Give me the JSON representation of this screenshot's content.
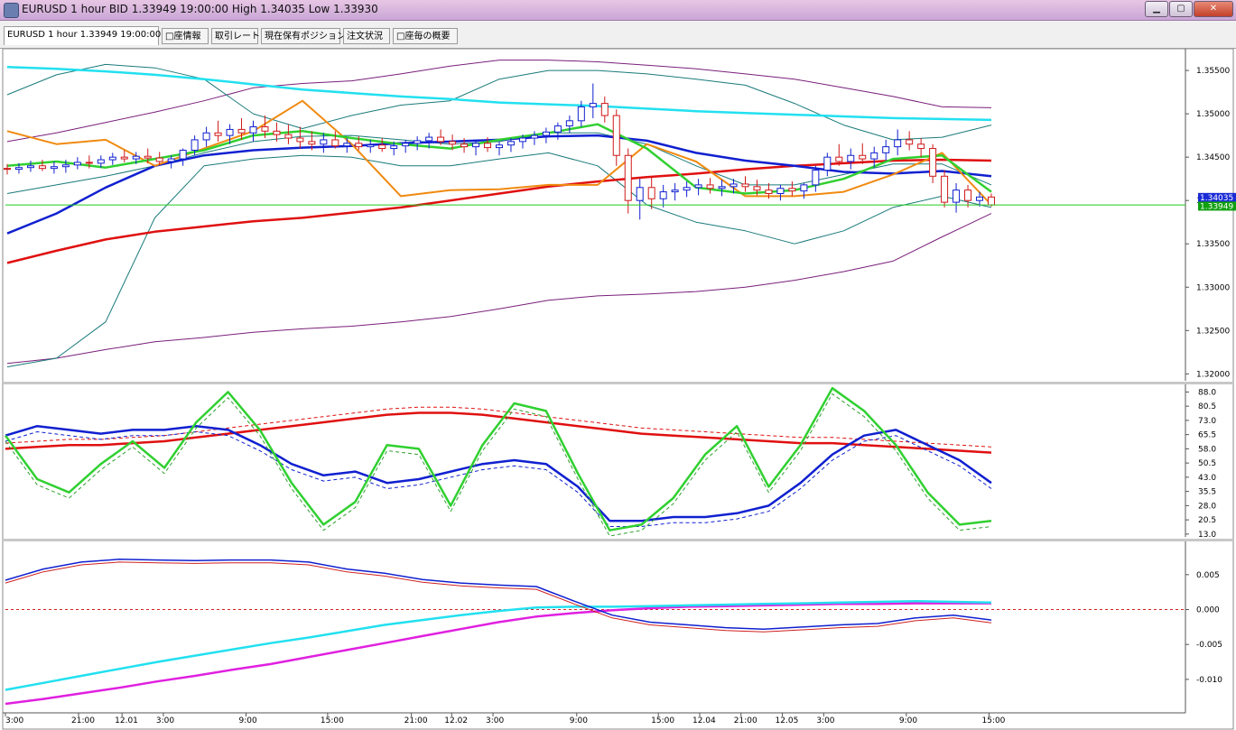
{
  "window": {
    "title": "EURUSD 1 hour BID 1.33949 19:00:00 High 1.34035 Low 1.33930",
    "controls": {
      "minimize": "▁",
      "maximize": "▢",
      "close": "✕"
    }
  },
  "tabs": [
    {
      "label": "EURUSD 1 hour 1.33949 19:00:00",
      "active": true
    },
    {
      "label": "□座情報"
    },
    {
      "label": "取引レート"
    },
    {
      "label": "現在保有ポジション"
    },
    {
      "label": "注文状況"
    },
    {
      "label": "□座毎の概要"
    }
  ],
  "chart_data": [
    {
      "type": "candlestick",
      "panel": "price",
      "y_ticks": [
        "1.35500",
        "1.35000",
        "1.34500",
        "1.34000",
        "1.33500",
        "1.33000",
        "1.32500",
        "1.32000"
      ],
      "ylim": [
        1.3192,
        1.3573
      ],
      "price_labels": [
        {
          "text": "1.34035",
          "value": 1.34035,
          "color": "#1a2bd6"
        },
        {
          "text": "1.33949",
          "value": 1.33935,
          "color": "#10a010"
        }
      ],
      "candles": [
        [
          1.3437,
          1.3442,
          1.343,
          1.3436
        ],
        [
          1.3436,
          1.3443,
          1.3431,
          1.3438
        ],
        [
          1.3438,
          1.3446,
          1.3433,
          1.344
        ],
        [
          1.344,
          1.3447,
          1.3434,
          1.3437
        ],
        [
          1.3437,
          1.3445,
          1.3431,
          1.3439
        ],
        [
          1.3439,
          1.3447,
          1.3432,
          1.3441
        ],
        [
          1.3441,
          1.345,
          1.3436,
          1.3444
        ],
        [
          1.3444,
          1.3452,
          1.3437,
          1.3443
        ],
        [
          1.3443,
          1.3452,
          1.3438,
          1.3447
        ],
        [
          1.3447,
          1.3455,
          1.3441,
          1.345
        ],
        [
          1.345,
          1.3458,
          1.3444,
          1.3448
        ],
        [
          1.3448,
          1.3456,
          1.3442,
          1.3451
        ],
        [
          1.3451,
          1.346,
          1.3443,
          1.3449
        ],
        [
          1.3449,
          1.3456,
          1.3441,
          1.3445
        ],
        [
          1.3445,
          1.3452,
          1.3437,
          1.3448
        ],
        [
          1.3448,
          1.346,
          1.344,
          1.3458
        ],
        [
          1.3458,
          1.3475,
          1.3452,
          1.347
        ],
        [
          1.347,
          1.3485,
          1.3462,
          1.3478
        ],
        [
          1.3478,
          1.3492,
          1.3468,
          1.3475
        ],
        [
          1.3475,
          1.3488,
          1.3465,
          1.3482
        ],
        [
          1.3482,
          1.3495,
          1.347,
          1.3478
        ],
        [
          1.3478,
          1.3492,
          1.3468,
          1.3485
        ],
        [
          1.3485,
          1.3498,
          1.3472,
          1.348
        ],
        [
          1.348,
          1.349,
          1.3468,
          1.3476
        ],
        [
          1.3476,
          1.3488,
          1.3465,
          1.3472
        ],
        [
          1.3472,
          1.3485,
          1.346,
          1.3468
        ],
        [
          1.3468,
          1.348,
          1.3458,
          1.3465
        ],
        [
          1.3465,
          1.3478,
          1.3455,
          1.347
        ],
        [
          1.347,
          1.348,
          1.346,
          1.3463
        ],
        [
          1.3463,
          1.3472,
          1.3455,
          1.3466
        ],
        [
          1.3466,
          1.3474,
          1.3458,
          1.3462
        ],
        [
          1.3462,
          1.347,
          1.3455,
          1.3464
        ],
        [
          1.3464,
          1.3472,
          1.3456,
          1.346
        ],
        [
          1.346,
          1.3468,
          1.3452,
          1.3463
        ],
        [
          1.3463,
          1.347,
          1.3455,
          1.3466
        ],
        [
          1.3466,
          1.3474,
          1.3458,
          1.3469
        ],
        [
          1.3469,
          1.3478,
          1.346,
          1.3473
        ],
        [
          1.3473,
          1.3482,
          1.3464,
          1.3468
        ],
        [
          1.3468,
          1.3476,
          1.3458,
          1.3465
        ],
        [
          1.3465,
          1.3472,
          1.3455,
          1.3462
        ],
        [
          1.3462,
          1.347,
          1.3452,
          1.3466
        ],
        [
          1.3466,
          1.3473,
          1.3456,
          1.3461
        ],
        [
          1.3461,
          1.3468,
          1.3452,
          1.3464
        ],
        [
          1.3464,
          1.3472,
          1.3456,
          1.3468
        ],
        [
          1.3468,
          1.3476,
          1.346,
          1.3472
        ],
        [
          1.3472,
          1.348,
          1.3464,
          1.3475
        ],
        [
          1.3475,
          1.3484,
          1.3466,
          1.3479
        ],
        [
          1.3479,
          1.349,
          1.347,
          1.3486
        ],
        [
          1.3486,
          1.3498,
          1.3478,
          1.3492
        ],
        [
          1.3492,
          1.3515,
          1.3485,
          1.3508
        ],
        [
          1.3508,
          1.3535,
          1.3495,
          1.3512
        ],
        [
          1.3512,
          1.352,
          1.349,
          1.3498
        ],
        [
          1.3498,
          1.3505,
          1.344,
          1.3452
        ],
        [
          1.3452,
          1.346,
          1.3385,
          1.34
        ],
        [
          1.34,
          1.3425,
          1.3378,
          1.3415
        ],
        [
          1.3415,
          1.3428,
          1.339,
          1.3402
        ],
        [
          1.3402,
          1.3418,
          1.3392,
          1.341
        ],
        [
          1.341,
          1.342,
          1.34,
          1.3412
        ],
        [
          1.3412,
          1.3422,
          1.3404,
          1.3415
        ],
        [
          1.3415,
          1.3425,
          1.3406,
          1.3418
        ],
        [
          1.3418,
          1.3426,
          1.3408,
          1.3414
        ],
        [
          1.3414,
          1.3424,
          1.3405,
          1.3416
        ],
        [
          1.3416,
          1.3425,
          1.3408,
          1.3419
        ],
        [
          1.3419,
          1.3428,
          1.341,
          1.3416
        ],
        [
          1.3416,
          1.3424,
          1.3406,
          1.3412
        ],
        [
          1.3412,
          1.342,
          1.3402,
          1.3408
        ],
        [
          1.3408,
          1.3418,
          1.34,
          1.3414
        ],
        [
          1.3414,
          1.3422,
          1.3405,
          1.3411
        ],
        [
          1.3411,
          1.342,
          1.3402,
          1.3418
        ],
        [
          1.3418,
          1.344,
          1.341,
          1.3435
        ],
        [
          1.3435,
          1.3455,
          1.3428,
          1.345
        ],
        [
          1.345,
          1.3465,
          1.344,
          1.3445
        ],
        [
          1.3445,
          1.346,
          1.3436,
          1.3452
        ],
        [
          1.3452,
          1.3466,
          1.3442,
          1.3448
        ],
        [
          1.3448,
          1.3462,
          1.3438,
          1.3455
        ],
        [
          1.3455,
          1.347,
          1.3446,
          1.3462
        ],
        [
          1.3462,
          1.3482,
          1.3452,
          1.347
        ],
        [
          1.347,
          1.348,
          1.3458,
          1.3465
        ],
        [
          1.3465,
          1.3472,
          1.345,
          1.346
        ],
        [
          1.346,
          1.3465,
          1.342,
          1.3428
        ],
        [
          1.3428,
          1.3435,
          1.3392,
          1.3398
        ],
        [
          1.3398,
          1.342,
          1.3386,
          1.3412
        ],
        [
          1.3412,
          1.3418,
          1.3392,
          1.34
        ],
        [
          1.34,
          1.341,
          1.3393,
          1.3404
        ],
        [
          1.3404,
          1.3408,
          1.3393,
          1.33949
        ]
      ],
      "bb_upper": [
        1.3522,
        1.3545,
        1.3557,
        1.3553,
        1.354,
        1.35,
        1.3483,
        1.3498,
        1.351,
        1.3515,
        1.354,
        1.355,
        1.355,
        1.3546,
        1.354,
        1.3533,
        1.3512,
        1.3487,
        1.347,
        1.3473,
        1.3487
      ],
      "bb_mid": [
        1.3408,
        1.3418,
        1.3428,
        1.344,
        1.3455,
        1.3468,
        1.3474,
        1.3475,
        1.347,
        1.3465,
        1.3468,
        1.3478,
        1.3478,
        1.3465,
        1.344,
        1.3418,
        1.3418,
        1.343,
        1.3442,
        1.3442,
        1.3418
      ],
      "bb_lower": [
        1.3208,
        1.3218,
        1.326,
        1.338,
        1.344,
        1.3448,
        1.3452,
        1.345,
        1.344,
        1.344,
        1.3448,
        1.3455,
        1.344,
        1.3395,
        1.3375,
        1.3365,
        1.335,
        1.3365,
        1.3392,
        1.3405,
        1.3392
      ],
      "env_upper": [
        1.3468,
        1.3478,
        1.349,
        1.3502,
        1.3515,
        1.353,
        1.3535,
        1.3538,
        1.3546,
        1.3555,
        1.3562,
        1.3562,
        1.356,
        1.3556,
        1.3552,
        1.3546,
        1.354,
        1.353,
        1.352,
        1.3508,
        1.3507
      ],
      "env_lower": [
        1.3212,
        1.3218,
        1.3228,
        1.3237,
        1.3242,
        1.3248,
        1.3252,
        1.3255,
        1.326,
        1.3266,
        1.3275,
        1.3285,
        1.329,
        1.3292,
        1.3295,
        1.33,
        1.3308,
        1.3318,
        1.333,
        1.3358,
        1.3385
      ],
      "ma_red": [
        1.3328,
        1.3342,
        1.3355,
        1.3364,
        1.337,
        1.3376,
        1.338,
        1.3386,
        1.3392,
        1.34,
        1.3408,
        1.3416,
        1.3422,
        1.3427,
        1.3431,
        1.3436,
        1.344,
        1.3443,
        1.3446,
        1.3447,
        1.3446
      ],
      "ma_blue": [
        1.3362,
        1.3385,
        1.3415,
        1.344,
        1.3452,
        1.3458,
        1.3461,
        1.3463,
        1.3466,
        1.3468,
        1.347,
        1.3474,
        1.3475,
        1.3469,
        1.3455,
        1.3446,
        1.344,
        1.3433,
        1.3431,
        1.3434,
        1.3428
      ],
      "ma_cyan": [
        1.3554,
        1.3552,
        1.3549,
        1.3545,
        1.354,
        1.3534,
        1.3528,
        1.3524,
        1.352,
        1.3517,
        1.3513,
        1.3511,
        1.3509,
        1.3506,
        1.3503,
        1.3501,
        1.3499,
        1.3497,
        1.3495,
        1.3494,
        1.3493
      ],
      "ma_green": [
        1.344,
        1.3445,
        1.3438,
        1.3448,
        1.3458,
        1.3475,
        1.348,
        1.3472,
        1.3465,
        1.346,
        1.347,
        1.3478,
        1.3488,
        1.346,
        1.3415,
        1.3408,
        1.3412,
        1.3425,
        1.3448,
        1.3452,
        1.341
      ],
      "ma_orange": [
        1.348,
        1.3465,
        1.347,
        1.344,
        1.346,
        1.348,
        1.3515,
        1.3465,
        1.3405,
        1.3412,
        1.3413,
        1.3418,
        1.3418,
        1.3465,
        1.3445,
        1.3405,
        1.3405,
        1.341,
        1.343,
        1.3455,
        1.3395
      ]
    },
    {
      "type": "line",
      "panel": "oscillator",
      "y_ticks": [
        "88.0",
        "80.5",
        "73.0",
        "65.5",
        "58.0",
        "50.5",
        "43.0",
        "35.5",
        "28.0",
        "20.5",
        "13.0"
      ],
      "ylim": [
        11.5,
        92
      ],
      "green": [
        65,
        42,
        35,
        50,
        62,
        48,
        72,
        88,
        68,
        40,
        18,
        30,
        60,
        58,
        28,
        60,
        82,
        78,
        45,
        15,
        18,
        32,
        55,
        70,
        38,
        60,
        90,
        78,
        60,
        35,
        18,
        20
      ],
      "blue": [
        65,
        70,
        68,
        66,
        68,
        68,
        70,
        68,
        60,
        50,
        44,
        46,
        40,
        42,
        46,
        50,
        52,
        50,
        38,
        20,
        20,
        22,
        22,
        24,
        28,
        40,
        55,
        65,
        68,
        60,
        52,
        40
      ],
      "red": [
        58,
        59,
        60,
        60,
        61,
        62,
        64,
        66,
        68,
        70,
        72,
        74,
        76,
        77,
        77,
        76,
        74,
        72,
        70,
        68,
        66,
        65,
        64,
        63,
        62,
        61,
        61,
        60,
        59,
        58,
        57,
        56
      ]
    },
    {
      "type": "line",
      "panel": "macd",
      "y_ticks": [
        "0.005",
        "0.000",
        "-0.005",
        "-0.010"
      ],
      "ylim": [
        -0.0135,
        0.0095
      ],
      "blue": [
        0.0042,
        0.0058,
        0.0068,
        0.0072,
        0.0071,
        0.007,
        0.0071,
        0.0071,
        0.0068,
        0.0058,
        0.0052,
        0.0043,
        0.0038,
        0.0035,
        0.0033,
        0.0012,
        -0.0008,
        -0.0018,
        -0.0022,
        -0.0026,
        -0.0028,
        -0.0025,
        -0.0022,
        -0.002,
        -0.0012,
        -0.0008,
        -0.0015
      ],
      "cyan": [
        -0.0115,
        -0.0105,
        -0.0095,
        -0.0085,
        -0.0075,
        -0.0066,
        -0.0057,
        -0.0048,
        -0.004,
        -0.0031,
        -0.0022,
        -0.0015,
        -0.0008,
        -0.0002,
        0.0003,
        0.0004,
        0.0004,
        0.0005,
        0.0006,
        0.0007,
        0.0008,
        0.0009,
        0.001,
        0.0011,
        0.0012,
        0.0011,
        0.001
      ],
      "magenta": [
        -0.0135,
        -0.0128,
        -0.012,
        -0.0112,
        -0.0103,
        -0.0095,
        -0.0086,
        -0.0078,
        -0.0068,
        -0.0058,
        -0.0048,
        -0.0038,
        -0.0028,
        -0.0018,
        -0.001,
        -0.0005,
        -0.0001,
        0.0002,
        0.0004,
        0.0005,
        0.0006,
        0.0007,
        0.0008,
        0.0008,
        0.0009,
        0.0009,
        0.0009
      ]
    }
  ],
  "x_axis_labels": [
    {
      "text": "3:00",
      "pos": 0.0
    },
    {
      "text": "21:00",
      "pos": 0.069
    },
    {
      "text": "12.01",
      "pos": 0.11
    },
    {
      "text": "3:00",
      "pos": 0.149
    },
    {
      "text": "9:00",
      "pos": 0.227
    },
    {
      "text": "15:00",
      "pos": 0.304
    },
    {
      "text": "21:00",
      "pos": 0.383
    },
    {
      "text": "12.02",
      "pos": 0.421
    },
    {
      "text": "3:00",
      "pos": 0.46
    },
    {
      "text": "9:00",
      "pos": 0.539
    },
    {
      "text": "15:00",
      "pos": 0.616
    },
    {
      "text": "12.04",
      "pos": 0.655
    },
    {
      "text": "21:00",
      "pos": 0.694
    },
    {
      "text": "12.05",
      "pos": 0.733
    },
    {
      "text": "3:00",
      "pos": 0.772
    },
    {
      "text": "9:00",
      "pos": 0.85
    },
    {
      "text": "15:00",
      "pos": 0.928
    }
  ]
}
